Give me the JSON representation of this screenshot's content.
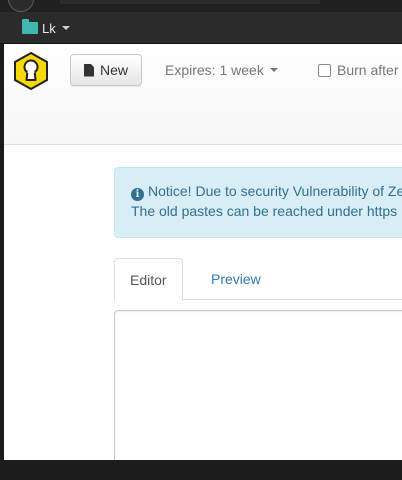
{
  "bookmarks": {
    "folder_label": "Lk"
  },
  "toolbar": {
    "new_label": "New",
    "expires_label": "Expires: 1 week",
    "burn_label": "Burn after"
  },
  "notice": {
    "line1": "Notice! Due to security Vulnerability of Ze",
    "line2": "The old pastes can be reached under https"
  },
  "tabs": [
    {
      "label": "Editor"
    },
    {
      "label": "Preview"
    }
  ],
  "colors": {
    "logo_fill": "#f5d90a",
    "alert_bg": "#d9edf7",
    "alert_text": "#31708f",
    "link": "#337ab7"
  }
}
